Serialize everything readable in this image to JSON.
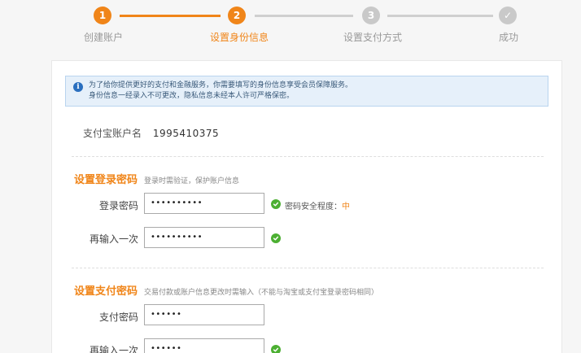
{
  "steps": [
    {
      "number": "1",
      "label": "创建账户"
    },
    {
      "number": "2",
      "label": "设置身份信息"
    },
    {
      "number": "3",
      "label": "设置支付方式"
    },
    {
      "number": "✓",
      "label": "成功"
    }
  ],
  "notice": {
    "line1": "为了给你提供更好的支付和金融服务，你需要填写的身份信息享受会员保障服务。",
    "line2": "身份信息一经录入不可更改，隐私信息未经本人许可严格保密。"
  },
  "account": {
    "label": "支付宝账户名",
    "value": "1995410375"
  },
  "login_section": {
    "title": "设置登录密码",
    "desc": "登录时需验证，保护账户信息",
    "password_label": "登录密码",
    "password_value": "••••••••••",
    "strength_label": "密码安全程度：",
    "strength_level": "中",
    "confirm_label": "再输入一次",
    "confirm_value": "••••••••••"
  },
  "pay_section": {
    "title": "设置支付密码",
    "desc": "交易付款或账户信息更改时需输入（不能与淘宝或支付宝登录密码相同）",
    "password_label": "支付密码",
    "password_value": "••••••",
    "confirm_label": "再输入一次",
    "confirm_value": "••••••"
  },
  "colors": {
    "accent": "#f08519",
    "inactive": "#c9c9c9",
    "success": "#4caf32",
    "notice_bg": "#e6f0fa"
  }
}
